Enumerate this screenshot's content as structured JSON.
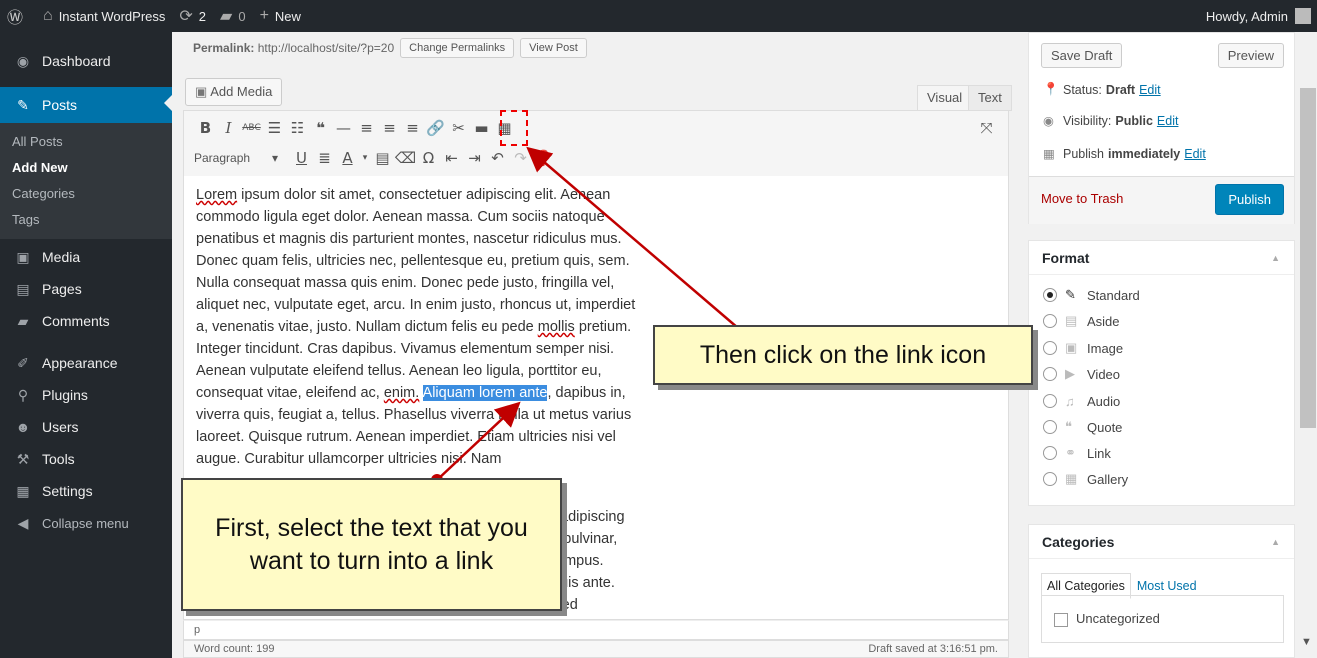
{
  "adminbar": {
    "site_name": "Instant WordPress",
    "updates_count": "2",
    "comments_count": "0",
    "new_label": "New",
    "howdy": "Howdy, Admin"
  },
  "menu": {
    "dashboard": "Dashboard",
    "posts": "Posts",
    "posts_sub": [
      "All Posts",
      "Add New",
      "Categories",
      "Tags"
    ],
    "media": "Media",
    "pages": "Pages",
    "comments": "Comments",
    "appearance": "Appearance",
    "plugins": "Plugins",
    "users": "Users",
    "tools": "Tools",
    "settings": "Settings",
    "collapse": "Collapse menu"
  },
  "permalink": {
    "label": "Permalink:",
    "url": "http://localhost/site/?p=20",
    "change_button": "Change Permalinks",
    "view_button": "View Post"
  },
  "editor": {
    "add_media": "Add Media",
    "tab_visual": "Visual",
    "tab_text": "Text",
    "format_select": "Paragraph",
    "text_before": "ipsum dolor sit amet, consectetuer adipiscing elit. Aenean commodo ligula eget dolor. Aenean massa. Cum sociis natoque penatibus et magnis dis parturient montes, nascetur ridiculus mus. Donec quam felis, ultricies nec, pellentesque eu, pretium quis, sem. Nulla consequat massa quis enim. Donec pede justo, fringilla vel, aliquet nec, vulputate eget, arcu. In enim justo, rhoncus ut, imperdiet a, venenatis vitae, justo. Nullam dictum felis eu pede ",
    "word_lorem": "Lorem",
    "word_mollis": "mollis",
    "text_mid": " pretium. Integer tincidunt. Cras dapibus. Vivamus elementum semper nisi. Aenean vulputate eleifend tellus. Aenean leo ligula, porttitor eu, consequat vitae, eleifend ac, ",
    "word_enim": "enim.",
    "selected_text": "Aliquam lorem ante",
    "text_after": ", dapibus in, viverra quis, feugiat a, tellus. Phasellus viverra nulla ut metus varius laoreet. Quisque rutrum. Aenean imperdiet. Etiam ultricies nisi vel augue. Curabitur ullamcorper ultricies nisi. Nam",
    "hidden_lines": [
      "t adipiscing",
      "s pulvinar,",
      "tempus.",
      "quis ante.",
      "Sed"
    ],
    "path": "p",
    "word_count": "Word count: 199",
    "draft_saved": "Draft saved at 3:16:51 pm."
  },
  "publish_box": {
    "save_draft": "Save Draft",
    "preview": "Preview",
    "status_label": "Status:",
    "status_value": "Draft",
    "visibility_label": "Visibility:",
    "visibility_value": "Public",
    "publish_label": "Publish",
    "publish_value": "immediately",
    "edit": "Edit",
    "move_to_trash": "Move to Trash",
    "publish_button": "Publish"
  },
  "format_box": {
    "title": "Format",
    "selected": "Standard",
    "options": [
      "Standard",
      "Aside",
      "Image",
      "Video",
      "Audio",
      "Quote",
      "Link",
      "Gallery"
    ]
  },
  "categories_box": {
    "title": "Categories",
    "tab_all": "All Categories",
    "tab_most_used": "Most Used",
    "items": [
      "Uncategorized"
    ]
  },
  "callouts": {
    "link_icon_hint": "Then click on the link icon",
    "select_text_hint": "First, select the text that you want to turn into a link"
  },
  "colors": {
    "admin_bar": "#23282d",
    "accent": "#0073aa",
    "selection": "#3b8de0",
    "callout_bg": "#fffbc6",
    "arrow": "#c00000"
  }
}
